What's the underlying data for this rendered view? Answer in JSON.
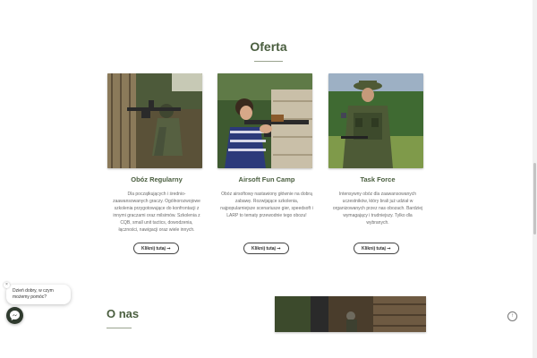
{
  "offer": {
    "title": "Oferta",
    "cards": [
      {
        "title": "Obóz Regularny",
        "description": "Dla początkujących i średnio-zaawansowanych graczy. Ogólnorozwojowe szkolenia przygotowujące do konfrontacji z innymi graczami oraz milsimów. Szkolenia z CQB, small unit tactics, dowodzenia, łączności, nawigacji oraz wiele innych.",
        "button": "Kliknij tutaj ➞"
      },
      {
        "title": "Airsoft Fun Camp",
        "description": "Obóz airsoftowy nastawiony głównie na dobrą zabawę. Rozwijające szkolenia, najpopularniejsze scenariusze gier, speedsoft i LARP to tematy przewodnie tego obozu!",
        "button": "Kliknij tutaj ➞"
      },
      {
        "title": "Task Force",
        "description": "Intensywny obóz dla zaawansowanych uczestników, który brali już udział w organizowanych przez nas obozach. Bardziej wymagający i trudniejszy. Tylko dla wybranych.",
        "button": "Kliknij tutaj ➞"
      }
    ]
  },
  "about": {
    "title": "O nas"
  },
  "chat": {
    "greeting": "Dzień dobry, w czym możemy pomóc?",
    "close": "×"
  },
  "scroll_top": {
    "glyph": "↑"
  },
  "colors": {
    "accent": "#4a5e3f",
    "messenger": "#2f3a2e"
  }
}
